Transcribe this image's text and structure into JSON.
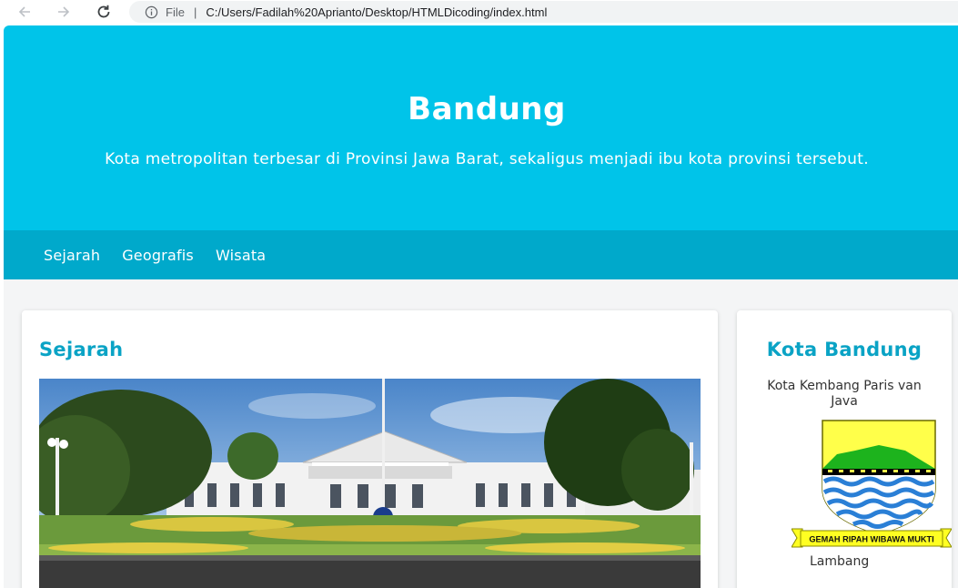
{
  "browser": {
    "scheme_label": "File",
    "separator": "|",
    "url": "C:/Users/Fadilah%20Aprianto/Desktop/HTMLDicoding/index.html"
  },
  "header": {
    "title": "Bandung",
    "tagline": "Kota metropolitan terbesar di Provinsi Jawa Barat, sekaligus menjadi ibu kota provinsi tersebut."
  },
  "nav": {
    "items": [
      {
        "label": "Sejarah"
      },
      {
        "label": "Geografis"
      },
      {
        "label": "Wisata"
      }
    ]
  },
  "main": {
    "section_title": "Sejarah"
  },
  "aside": {
    "title": "Kota Bandung",
    "subtitle": "Kota Kembang Paris van Java",
    "emblem_motto": "GEMAH RIPAH WIBAWA MUKTI",
    "emblem_caption": "Lambang"
  },
  "colors": {
    "hero": "#00c4e9",
    "navbar": "#00a9cb",
    "heading": "#0aa3c5"
  }
}
